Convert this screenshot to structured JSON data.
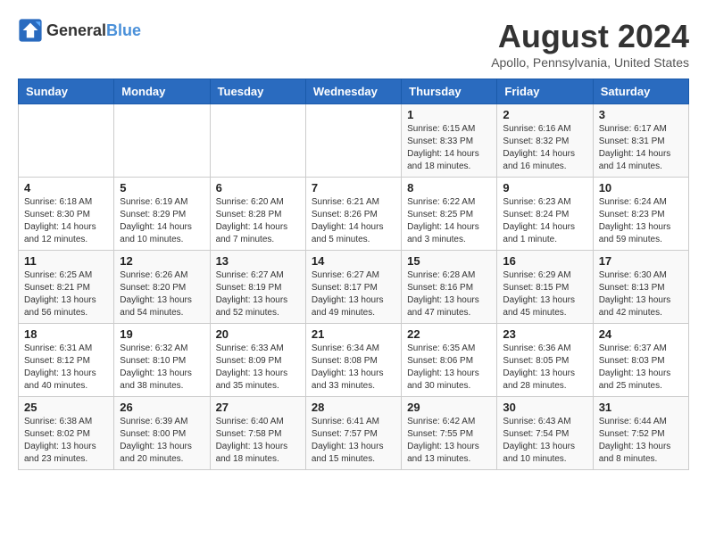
{
  "logo": {
    "general": "General",
    "blue": "Blue"
  },
  "title": "August 2024",
  "location": "Apollo, Pennsylvania, United States",
  "headers": [
    "Sunday",
    "Monday",
    "Tuesday",
    "Wednesday",
    "Thursday",
    "Friday",
    "Saturday"
  ],
  "weeks": [
    [
      {
        "day": "",
        "info": ""
      },
      {
        "day": "",
        "info": ""
      },
      {
        "day": "",
        "info": ""
      },
      {
        "day": "",
        "info": ""
      },
      {
        "day": "1",
        "info": "Sunrise: 6:15 AM\nSunset: 8:33 PM\nDaylight: 14 hours\nand 18 minutes."
      },
      {
        "day": "2",
        "info": "Sunrise: 6:16 AM\nSunset: 8:32 PM\nDaylight: 14 hours\nand 16 minutes."
      },
      {
        "day": "3",
        "info": "Sunrise: 6:17 AM\nSunset: 8:31 PM\nDaylight: 14 hours\nand 14 minutes."
      }
    ],
    [
      {
        "day": "4",
        "info": "Sunrise: 6:18 AM\nSunset: 8:30 PM\nDaylight: 14 hours\nand 12 minutes."
      },
      {
        "day": "5",
        "info": "Sunrise: 6:19 AM\nSunset: 8:29 PM\nDaylight: 14 hours\nand 10 minutes."
      },
      {
        "day": "6",
        "info": "Sunrise: 6:20 AM\nSunset: 8:28 PM\nDaylight: 14 hours\nand 7 minutes."
      },
      {
        "day": "7",
        "info": "Sunrise: 6:21 AM\nSunset: 8:26 PM\nDaylight: 14 hours\nand 5 minutes."
      },
      {
        "day": "8",
        "info": "Sunrise: 6:22 AM\nSunset: 8:25 PM\nDaylight: 14 hours\nand 3 minutes."
      },
      {
        "day": "9",
        "info": "Sunrise: 6:23 AM\nSunset: 8:24 PM\nDaylight: 14 hours\nand 1 minute."
      },
      {
        "day": "10",
        "info": "Sunrise: 6:24 AM\nSunset: 8:23 PM\nDaylight: 13 hours\nand 59 minutes."
      }
    ],
    [
      {
        "day": "11",
        "info": "Sunrise: 6:25 AM\nSunset: 8:21 PM\nDaylight: 13 hours\nand 56 minutes."
      },
      {
        "day": "12",
        "info": "Sunrise: 6:26 AM\nSunset: 8:20 PM\nDaylight: 13 hours\nand 54 minutes."
      },
      {
        "day": "13",
        "info": "Sunrise: 6:27 AM\nSunset: 8:19 PM\nDaylight: 13 hours\nand 52 minutes."
      },
      {
        "day": "14",
        "info": "Sunrise: 6:27 AM\nSunset: 8:17 PM\nDaylight: 13 hours\nand 49 minutes."
      },
      {
        "day": "15",
        "info": "Sunrise: 6:28 AM\nSunset: 8:16 PM\nDaylight: 13 hours\nand 47 minutes."
      },
      {
        "day": "16",
        "info": "Sunrise: 6:29 AM\nSunset: 8:15 PM\nDaylight: 13 hours\nand 45 minutes."
      },
      {
        "day": "17",
        "info": "Sunrise: 6:30 AM\nSunset: 8:13 PM\nDaylight: 13 hours\nand 42 minutes."
      }
    ],
    [
      {
        "day": "18",
        "info": "Sunrise: 6:31 AM\nSunset: 8:12 PM\nDaylight: 13 hours\nand 40 minutes."
      },
      {
        "day": "19",
        "info": "Sunrise: 6:32 AM\nSunset: 8:10 PM\nDaylight: 13 hours\nand 38 minutes."
      },
      {
        "day": "20",
        "info": "Sunrise: 6:33 AM\nSunset: 8:09 PM\nDaylight: 13 hours\nand 35 minutes."
      },
      {
        "day": "21",
        "info": "Sunrise: 6:34 AM\nSunset: 8:08 PM\nDaylight: 13 hours\nand 33 minutes."
      },
      {
        "day": "22",
        "info": "Sunrise: 6:35 AM\nSunset: 8:06 PM\nDaylight: 13 hours\nand 30 minutes."
      },
      {
        "day": "23",
        "info": "Sunrise: 6:36 AM\nSunset: 8:05 PM\nDaylight: 13 hours\nand 28 minutes."
      },
      {
        "day": "24",
        "info": "Sunrise: 6:37 AM\nSunset: 8:03 PM\nDaylight: 13 hours\nand 25 minutes."
      }
    ],
    [
      {
        "day": "25",
        "info": "Sunrise: 6:38 AM\nSunset: 8:02 PM\nDaylight: 13 hours\nand 23 minutes."
      },
      {
        "day": "26",
        "info": "Sunrise: 6:39 AM\nSunset: 8:00 PM\nDaylight: 13 hours\nand 20 minutes."
      },
      {
        "day": "27",
        "info": "Sunrise: 6:40 AM\nSunset: 7:58 PM\nDaylight: 13 hours\nand 18 minutes."
      },
      {
        "day": "28",
        "info": "Sunrise: 6:41 AM\nSunset: 7:57 PM\nDaylight: 13 hours\nand 15 minutes."
      },
      {
        "day": "29",
        "info": "Sunrise: 6:42 AM\nSunset: 7:55 PM\nDaylight: 13 hours\nand 13 minutes."
      },
      {
        "day": "30",
        "info": "Sunrise: 6:43 AM\nSunset: 7:54 PM\nDaylight: 13 hours\nand 10 minutes."
      },
      {
        "day": "31",
        "info": "Sunrise: 6:44 AM\nSunset: 7:52 PM\nDaylight: 13 hours\nand 8 minutes."
      }
    ]
  ]
}
